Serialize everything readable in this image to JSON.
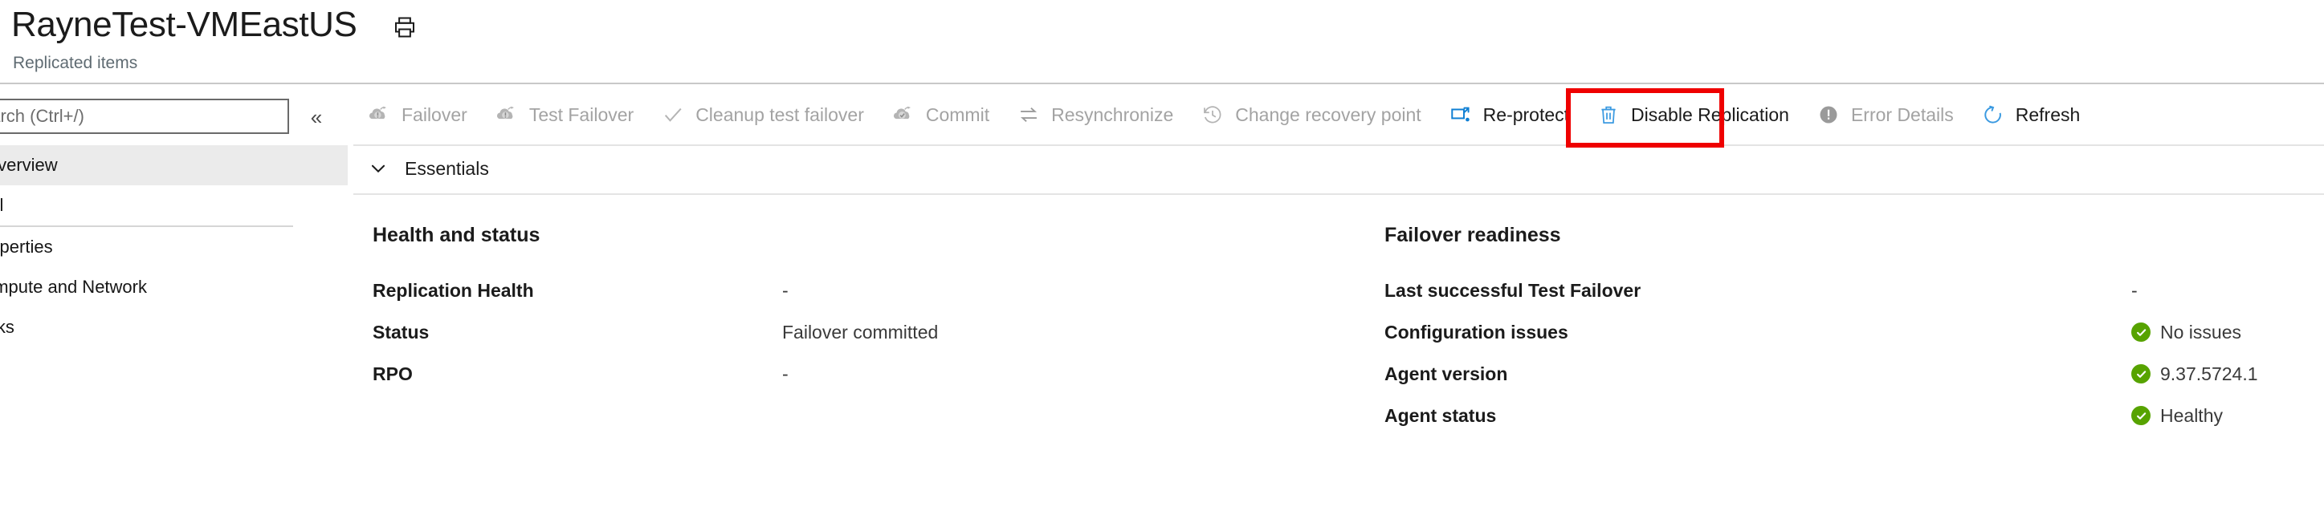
{
  "header": {
    "title": "RayneTest-VMEastUS",
    "subtitle": "Replicated items",
    "print_icon": "print-icon"
  },
  "sidebar": {
    "search": {
      "placeholder": "earch (Ctrl+/)",
      "value": ""
    },
    "collapse_label": "«",
    "items": [
      {
        "label": "Overview",
        "selected": true,
        "type": "item"
      },
      {
        "label": "ral",
        "selected": false,
        "type": "section"
      },
      {
        "label": "roperties",
        "selected": false,
        "type": "item"
      },
      {
        "label": "ompute and Network",
        "selected": false,
        "type": "item"
      },
      {
        "label": "isks",
        "selected": false,
        "type": "item"
      }
    ]
  },
  "toolbar": {
    "items": [
      {
        "label": "Failover",
        "icon": "failover-icon",
        "enabled": false
      },
      {
        "label": "Test Failover",
        "icon": "test-failover-icon",
        "enabled": false
      },
      {
        "label": "Cleanup test failover",
        "icon": "check-icon",
        "enabled": false
      },
      {
        "label": "Commit",
        "icon": "commit-icon",
        "enabled": false
      },
      {
        "label": "Resynchronize",
        "icon": "resynchronize-icon",
        "enabled": false
      },
      {
        "label": "Change recovery point",
        "icon": "clock-history-icon",
        "enabled": false
      },
      {
        "label": "Re-protect",
        "icon": "re-protect-icon",
        "enabled": true
      },
      {
        "label": "Disable Replication",
        "icon": "trash-icon",
        "enabled": true
      },
      {
        "label": "Error Details",
        "icon": "error-icon",
        "enabled": false
      },
      {
        "label": "Refresh",
        "icon": "refresh-icon",
        "enabled": true
      }
    ],
    "highlight": {
      "target_label": "Re-protect",
      "color": "#ef0000"
    }
  },
  "essentials": {
    "section_label": "Essentials",
    "expanded": true,
    "chevron_icon": "chevron-down-icon",
    "left_pane": {
      "title": "Health and status",
      "rows": [
        {
          "label": "Replication Health",
          "value": "-",
          "status": null
        },
        {
          "label": "Status",
          "value": "Failover committed",
          "status": null
        },
        {
          "label": "RPO",
          "value": "-",
          "status": null
        }
      ]
    },
    "right_pane": {
      "title": "Failover readiness",
      "rows": [
        {
          "label": "Last successful Test Failover",
          "value": "-",
          "status": null
        },
        {
          "label": "Configuration issues",
          "value": "No issues",
          "status": "ok"
        },
        {
          "label": "Agent version",
          "value": "9.37.5724.1",
          "status": "ok"
        },
        {
          "label": "Agent status",
          "value": "Healthy",
          "status": "ok"
        }
      ]
    }
  },
  "colors": {
    "status_ok": "#57a300",
    "accent": "#0078d4",
    "annotation": "#ef0000",
    "selected_row": "#ebebeb"
  }
}
